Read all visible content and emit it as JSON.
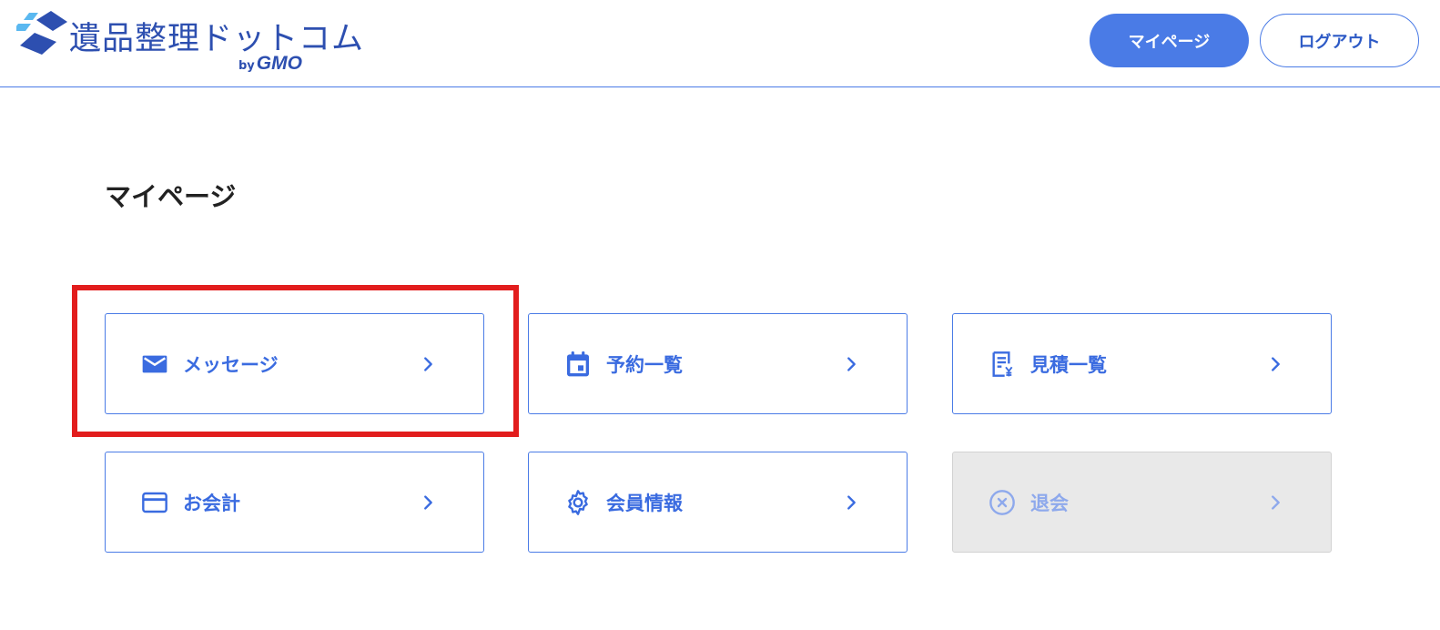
{
  "header": {
    "logo_text": "遺品整理ドットコム",
    "logo_by": "by",
    "logo_brand": "GMO",
    "mypage_button": "マイページ",
    "logout_button": "ログアウト"
  },
  "page": {
    "title": "マイページ"
  },
  "menu": [
    {
      "label": "メッセージ",
      "icon": "mail-icon"
    },
    {
      "label": "予約一覧",
      "icon": "calendar-icon"
    },
    {
      "label": "見積一覧",
      "icon": "receipt-yen-icon"
    },
    {
      "label": "お会計",
      "icon": "credit-card-icon"
    },
    {
      "label": "会員情報",
      "icon": "gear-icon"
    },
    {
      "label": "退会",
      "icon": "cancel-circle-icon",
      "disabled": true
    }
  ],
  "colors": {
    "accent": "#4a7be6",
    "brand": "#2d4fb0",
    "highlight": "#e21d1d",
    "disabled_bg": "#e9e9e9"
  }
}
